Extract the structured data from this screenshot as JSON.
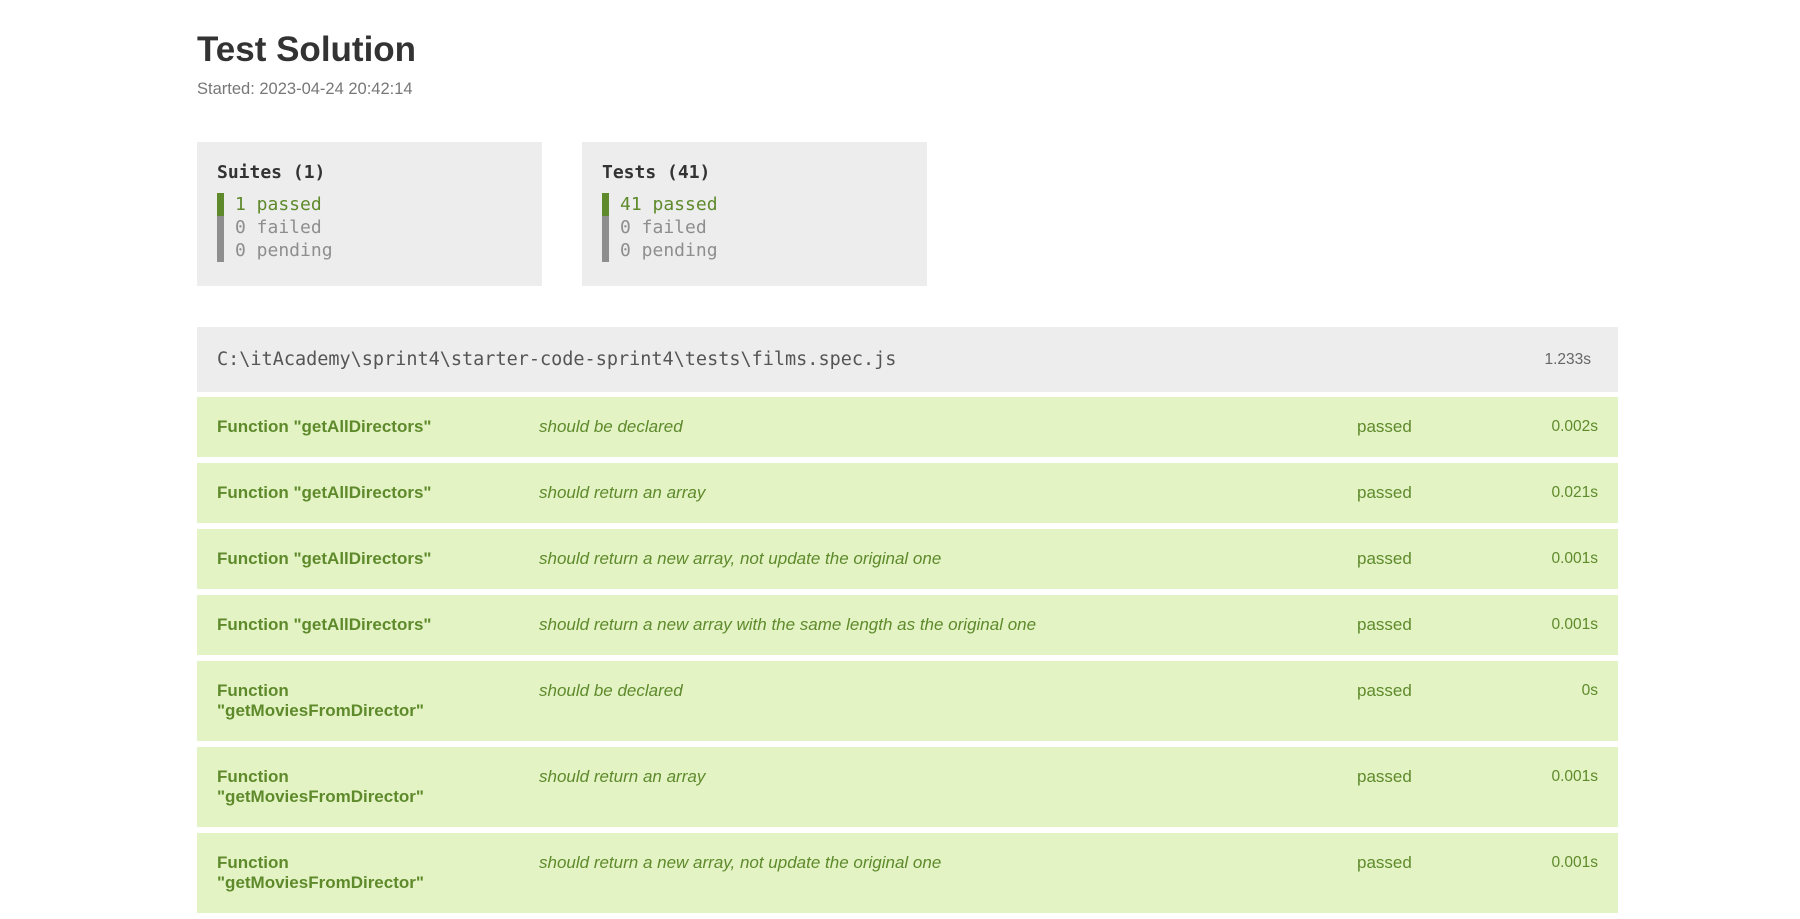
{
  "report": {
    "title": "Test Solution",
    "started": "Started: 2023-04-24 20:42:14"
  },
  "summary": {
    "suites": {
      "title": "Suites (1)",
      "passed": "1 passed",
      "failed": "0 failed",
      "pending": "0 pending"
    },
    "tests": {
      "title": "Tests (41)",
      "passed": "41 passed",
      "failed": "0 failed",
      "pending": "0 pending"
    }
  },
  "suite": {
    "path": "C:\\itAcademy\\sprint4\\starter-code-sprint4\\tests\\films.spec.js",
    "duration": "1.233s"
  },
  "rows": [
    {
      "suite": "Function \"getAllDirectors\"",
      "test": "should be declared",
      "status": "passed",
      "time": "0.002s"
    },
    {
      "suite": "Function \"getAllDirectors\"",
      "test": "should return an array",
      "status": "passed",
      "time": "0.021s"
    },
    {
      "suite": "Function \"getAllDirectors\"",
      "test": "should return a new array, not update the original one",
      "status": "passed",
      "time": "0.001s"
    },
    {
      "suite": "Function \"getAllDirectors\"",
      "test": "should return a new array with the same length as the original one",
      "status": "passed",
      "time": "0.001s"
    },
    {
      "suite": "Function \"getMoviesFromDirector\"",
      "test": "should be declared",
      "status": "passed",
      "time": "0s"
    },
    {
      "suite": "Function \"getMoviesFromDirector\"",
      "test": "should return an array",
      "status": "passed",
      "time": "0.001s"
    },
    {
      "suite": "Function \"getMoviesFromDirector\"",
      "test": "should return a new array, not update the original one",
      "status": "passed",
      "time": "0.001s"
    }
  ],
  "colors": {
    "passed": "#5e8a2b",
    "row_background": "#e3f3c4",
    "panel_background": "#ededed"
  }
}
